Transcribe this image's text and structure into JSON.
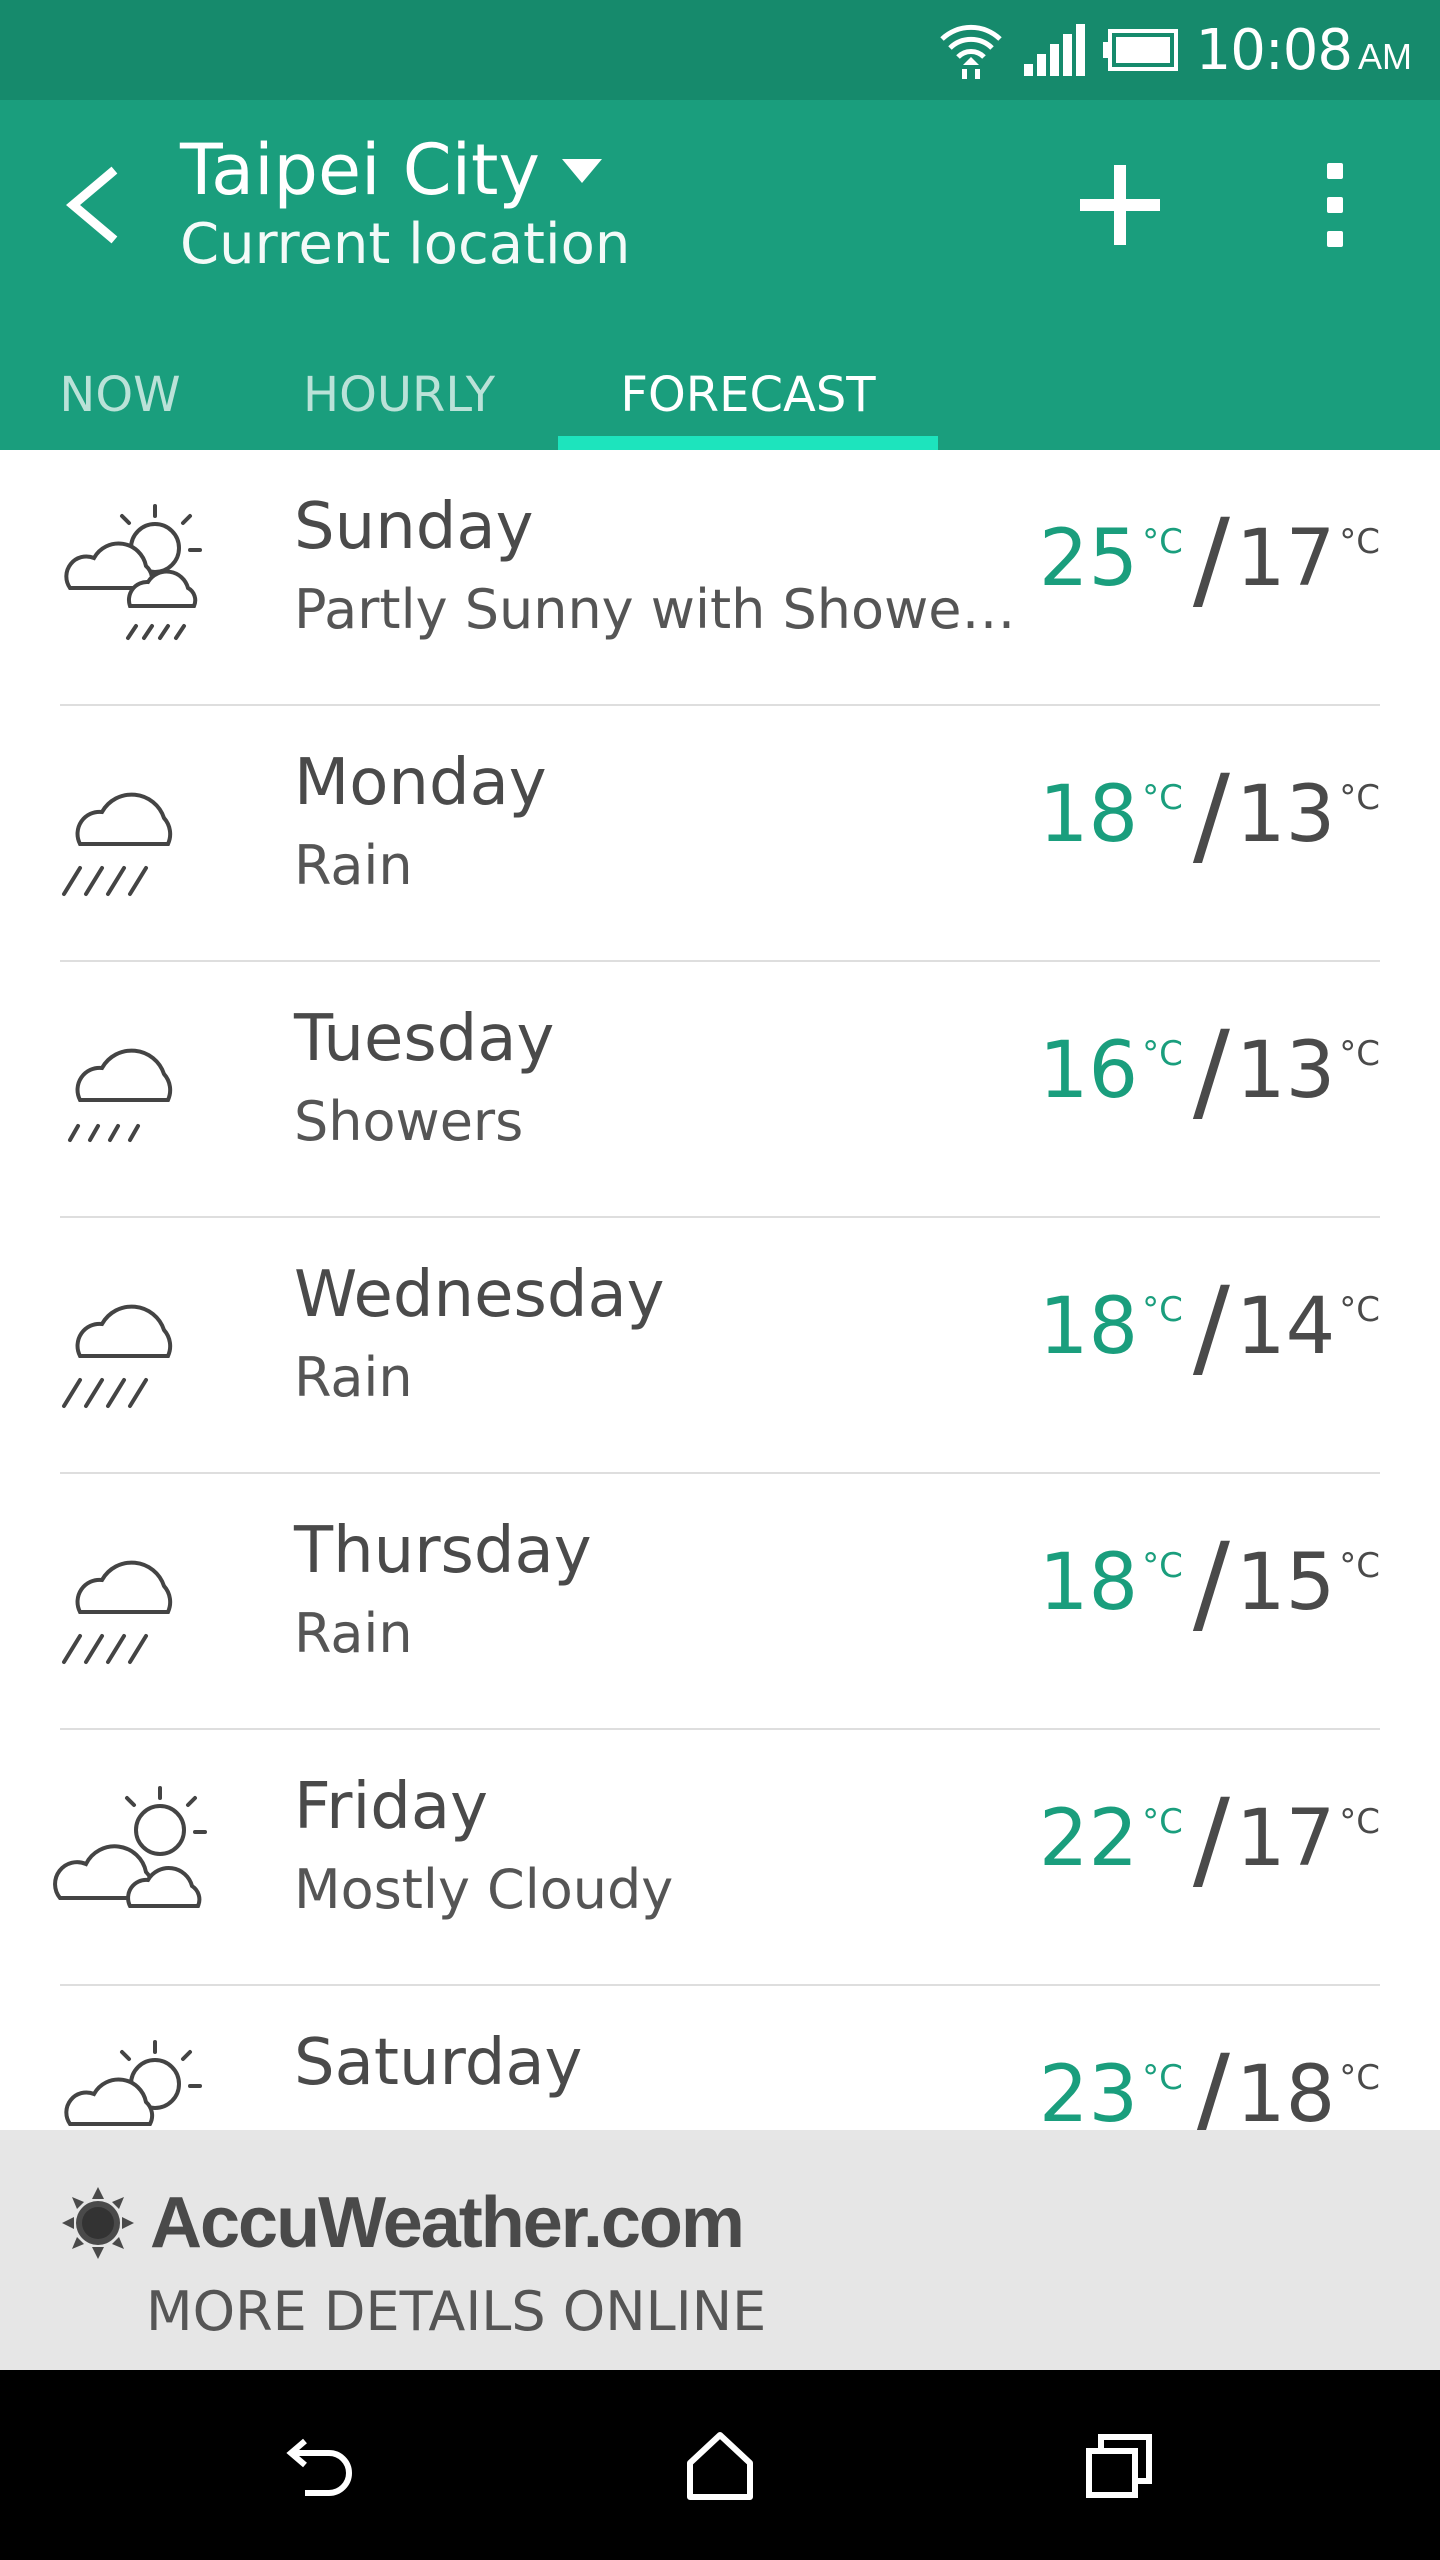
{
  "status_bar": {
    "time": "10:08",
    "ampm": "AM",
    "icons": [
      "wifi-icon",
      "signal-icon",
      "battery-icon"
    ]
  },
  "app_bar": {
    "city": "Taipei City",
    "subtitle": "Current location",
    "icons": [
      "back-arrow-icon",
      "caret-down-icon",
      "plus-icon",
      "overflow-menu-icon"
    ]
  },
  "tabs": [
    {
      "label": "NOW",
      "active": false
    },
    {
      "label": "HOURLY",
      "active": false
    },
    {
      "label": "FORECAST",
      "active": true
    }
  ],
  "forecast": [
    {
      "day": "Sunday",
      "condition": "Partly Sunny with Showe…",
      "high": "25",
      "low": "17",
      "unit": "°C",
      "icon": "partly-sunny-showers-icon"
    },
    {
      "day": "Monday",
      "condition": "Rain",
      "high": "18",
      "low": "13",
      "unit": "°C",
      "icon": "rain-icon"
    },
    {
      "day": "Tuesday",
      "condition": "Showers",
      "high": "16",
      "low": "13",
      "unit": "°C",
      "icon": "showers-icon"
    },
    {
      "day": "Wednesday",
      "condition": "Rain",
      "high": "18",
      "low": "14",
      "unit": "°C",
      "icon": "rain-icon"
    },
    {
      "day": "Thursday",
      "condition": "Rain",
      "high": "18",
      "low": "15",
      "unit": "°C",
      "icon": "rain-icon"
    },
    {
      "day": "Friday",
      "condition": "Mostly Cloudy",
      "high": "22",
      "low": "17",
      "unit": "°C",
      "icon": "mostly-cloudy-icon"
    },
    {
      "day": "Saturday",
      "condition": "",
      "high": "23",
      "low": "18",
      "unit": "°C",
      "icon": "partly-sunny-icon"
    }
  ],
  "footer": {
    "brand": "AccuWeather.com",
    "link": "MORE DETAILS ONLINE",
    "icon": "accuweather-sun-icon"
  },
  "nav_bar": {
    "icons": [
      "nav-back-icon",
      "nav-home-icon",
      "nav-recents-icon"
    ]
  },
  "colors": {
    "status_bar": "#168a6c",
    "app_bar": "#1a9e7d",
    "tab_indicator": "#1de4bd",
    "high_temp": "#1a9e7d",
    "footer_bg": "#e6e6e6"
  }
}
